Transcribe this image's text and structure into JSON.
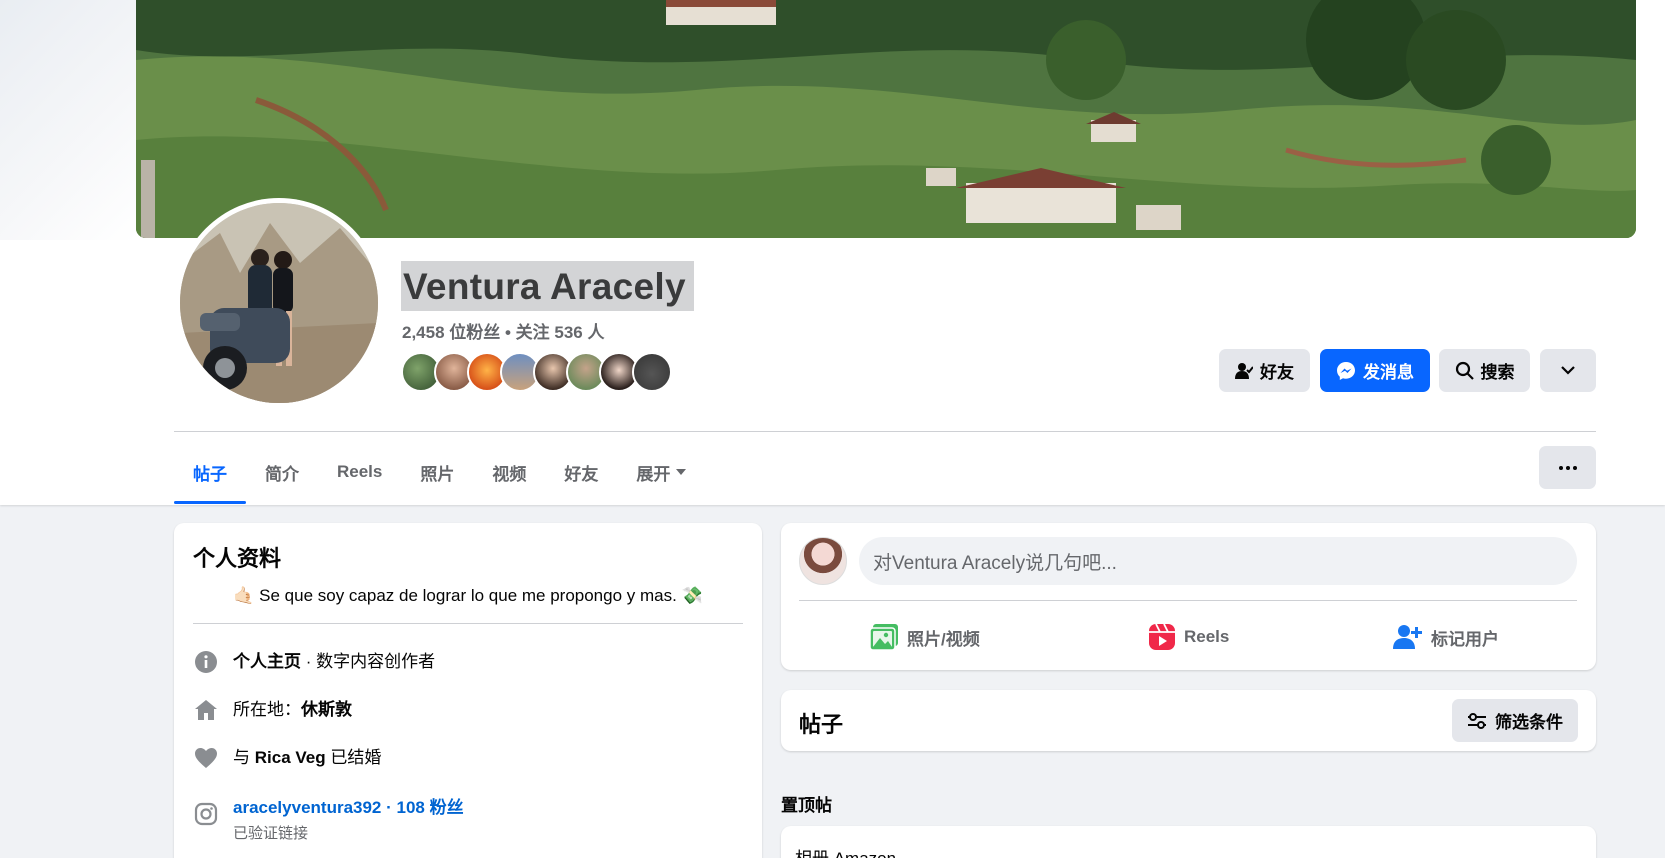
{
  "profile": {
    "name": "Ventura Aracely",
    "stats": "2,458 位粉丝 • 关注 536 人"
  },
  "actions": {
    "friends_label": "好友",
    "message_label": "发消息",
    "search_label": "搜索"
  },
  "tabs": [
    {
      "label": "帖子"
    },
    {
      "label": "简介"
    },
    {
      "label": "Reels"
    },
    {
      "label": "照片"
    },
    {
      "label": "视频"
    },
    {
      "label": "好友"
    },
    {
      "label": "展开"
    }
  ],
  "intro": {
    "title": "个人资料",
    "bio": "Se que soy capaz de lograr lo que me propongo y mas.",
    "page_label": "个人主页",
    "page_category": " · 数字内容创作者",
    "location_prefix": "所在地：",
    "location": "休斯敦",
    "relationship_prefix": "与 ",
    "relationship_name": "Rica Veg",
    "relationship_suffix": " 已结婚",
    "instagram_handle": "aracelyventura392 · 108 粉丝",
    "instagram_note": "已验证链接"
  },
  "composer": {
    "placeholder": "对Ventura Aracely说几句吧...",
    "photo_video": "照片/视频",
    "reels": "Reels",
    "tag_people": "标记用户"
  },
  "posts": {
    "title": "帖子",
    "filter_label": "筛选条件",
    "pinned_label": "置顶帖",
    "pinned_preview": "相册 Amazon"
  },
  "colors": {
    "accent": "#0866ff",
    "link": "#0064d1",
    "secondary_text": "#65676b",
    "button_gray": "#e4e6eb",
    "page_bg": "#f0f2f5"
  }
}
